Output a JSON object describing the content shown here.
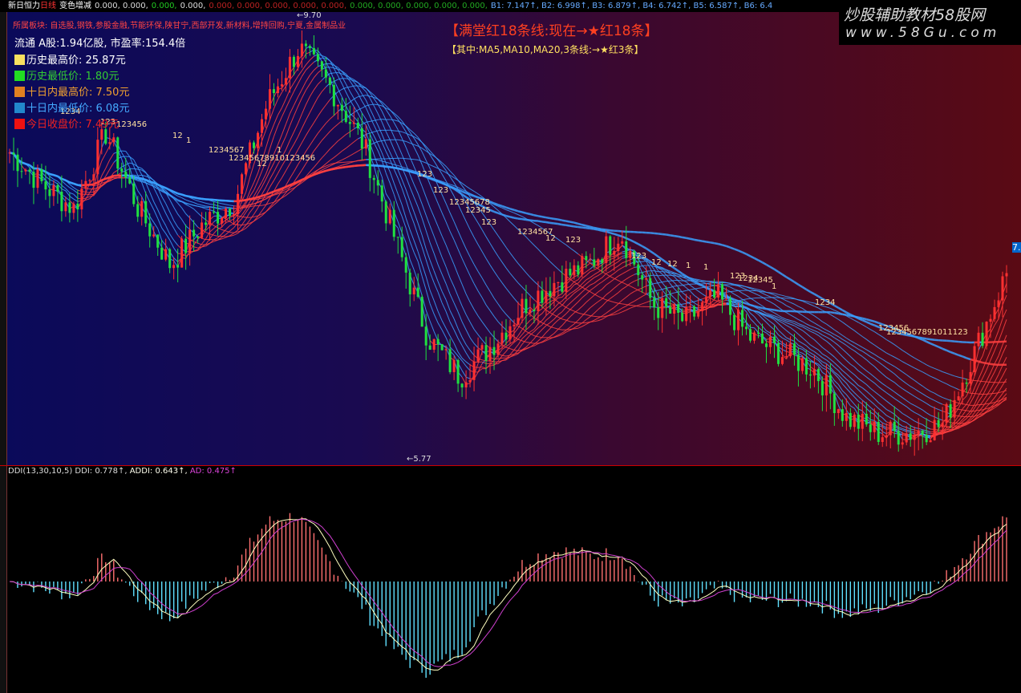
{
  "header": {
    "title": "新日恒力",
    "period": "日线",
    "indicator": "变色增减",
    "values_white": "0.000, 0.000,",
    "values_green": "0.000,",
    "values_white2": "0.000,",
    "values_red": "0.000, 0.000, 0.000, 0.000, 0.000,",
    "values_green2": "0.000, 0.000, 0.000, 0.000, 0.000,",
    "b_values": "B1: 7.147↑, B2: 6.998↑, B3: 6.879↑, B4: 6.742↑, B5: 6.587↑, B6: 6.4"
  },
  "sectors": "所属板块: 自选股,钢铁,参股金融,节能环保,陕甘宁,西部开发,新材料,增持回购,宁夏,金属制品业",
  "banner": {
    "line1": "【满堂红18条线:现在→★红18条】",
    "line2": "【其中:MA5,MA10,MA20,3条线:→★红3条】"
  },
  "info": {
    "float": "流通 A股:1.94亿股,   市盈率:154.4倍",
    "hist_high": "历史最高价:    25.87元",
    "hist_low": "历史最低价:    1.80元",
    "ten_high": "十日内最高价: 7.50元",
    "ten_low": "十日内最低价: 6.08元",
    "current": "今日收盘价:  7.49元"
  },
  "logo": {
    "cn": "炒股辅助教材58股网",
    "url": "www.58Gu.com"
  },
  "price_axis": {
    "right_label": "7."
  },
  "annotations": [
    "1234",
    "123",
    "123456",
    "12",
    "1",
    "1234567",
    "12345678910123456",
    "12",
    "1",
    "123",
    "123",
    "12345678",
    "12345",
    "123",
    "1234567",
    "12",
    "123",
    "123",
    "12",
    "12",
    "1",
    "1",
    "123",
    "1234",
    "12345",
    "1",
    "1234",
    "123456",
    "1234567891011123"
  ],
  "colors": {
    "up": "#ff3030",
    "down": "#20e040",
    "ma_up": "#ff4040",
    "ma_down": "#3aa0ff",
    "hist_pos": "#ff7070",
    "hist_neg": "#60e0ff"
  },
  "chart_data": {
    "type": "candlestick",
    "high_label": "9.70",
    "low_label": "5.77",
    "ylim": [
      5.77,
      9.7
    ],
    "close_keypoints": [
      8.49,
      8.21,
      7.99,
      8.67,
      7.99,
      7.49,
      7.85,
      8.06,
      8.92,
      9.42,
      9.06,
      8.56,
      7.71,
      6.85,
      6.5,
      6.78,
      7.14,
      7.35,
      7.49,
      7.78,
      7.14,
      6.99,
      7.21,
      6.85,
      6.71,
      6.57,
      6.14,
      6.0,
      6.0,
      6.07,
      6.71,
      7.42
    ],
    "ma_periods": [
      3,
      5,
      8,
      10,
      13,
      15,
      18,
      21,
      25,
      30,
      34,
      40,
      45,
      50,
      60,
      70,
      90,
      120
    ],
    "indicator": {
      "title": "DDI(13,30,10,5)",
      "ddi_label": "DDI: 0.778↑,",
      "addi_label": "ADDI: 0.643↑,",
      "ad_label": "AD: 0.475↑"
    }
  }
}
